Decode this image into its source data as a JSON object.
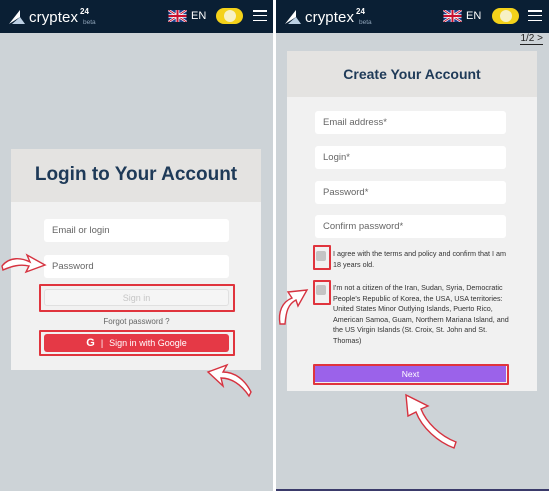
{
  "brand": {
    "name": "cryptex",
    "superscript": "24",
    "tag": "beta"
  },
  "language": "EN",
  "login": {
    "title": "Login to Your Account",
    "email_placeholder": "Email or login",
    "password_placeholder": "Password",
    "signin_label": "Sign in",
    "forgot_label": "Forgot password ?",
    "google_icon": "G",
    "google_separator": "|",
    "google_label": "Sign in with Google"
  },
  "register": {
    "pager": "1/2 >",
    "title": "Create Your Account",
    "email_placeholder": "Email address*",
    "login_placeholder": "Login*",
    "password_placeholder": "Password*",
    "confirm_placeholder": "Confirm password*",
    "terms_text": "I agree with the terms and policy and confirm that I am 18 years old.",
    "citizen_text": "I'm not a citizen of the Iran, Sudan, Syria, Democratic People's Republic of Korea, the USA, USA territories: United States Minor Outlying Islands, Puerto Rico, American Samoa, Guam, Northern Mariana Island, and the US Virgin Islands (St. Croix, St. John and St. Thomas)",
    "next_label": "Next"
  },
  "colors": {
    "topbar": "#0a1f34",
    "google": "#e53946",
    "next": "#9b62ea",
    "highlight": "#e0343d",
    "title": "#1e3a58"
  }
}
